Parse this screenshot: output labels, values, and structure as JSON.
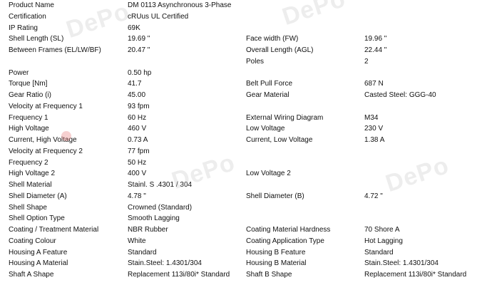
{
  "watermark": {
    "text": "DePo",
    "color": "#bebebe"
  },
  "rows": [
    {
      "c1": "Product Name",
      "c2": "DM 0113 Asynchronous 3-Phase",
      "c3": "",
      "c4": ""
    },
    {
      "c1": "Certification",
      "c2": "cRUus UL Certified",
      "c3": "",
      "c4": ""
    },
    {
      "c1": "IP Rating",
      "c2": "69K",
      "c3": "",
      "c4": ""
    },
    {
      "c1": "Shell Length (SL)",
      "c2": "19.69 \"",
      "c3": "Face width (FW)",
      "c4": "19.96 \""
    },
    {
      "c1": "Between Frames (EL/LW/BF)",
      "c2": "20.47 \"",
      "c3": "Overall Length (AGL)",
      "c4": "22.44 \""
    },
    {
      "c1": "",
      "c2": "",
      "c3": "Poles",
      "c4": "2"
    },
    {
      "c1": "Power",
      "c2": "0.50 hp",
      "c3": "",
      "c4": ""
    },
    {
      "c1": "Torque [Nm]",
      "c2": "41.7",
      "c3": "Belt Pull Force",
      "c4": "687 N"
    },
    {
      "c1": "Gear Ratio (i)",
      "c2": "45.00",
      "c3": "Gear Material",
      "c4": "Casted Steel: GGG-40"
    },
    {
      "c1": "Velocity at Frequency 1",
      "c2": "93 fpm",
      "c3": "",
      "c4": ""
    },
    {
      "c1": "Frequency 1",
      "c2": "60 Hz",
      "c3": "External Wiring Diagram",
      "c4": "M34"
    },
    {
      "c1": "High Voltage",
      "c2": "460 V",
      "c3": "Low Voltage",
      "c4": "230 V"
    },
    {
      "c1": "Current, High Voltage",
      "c2": "0.73 A",
      "c3": "Current, Low Voltage",
      "c4": "1.38 A"
    },
    {
      "c1": "Velocity at Frequency 2",
      "c2": "77 fpm",
      "c3": "",
      "c4": ""
    },
    {
      "c1": "Frequency 2",
      "c2": "50 Hz",
      "c3": "",
      "c4": ""
    },
    {
      "c1": "High Voltage 2",
      "c2": "400 V",
      "c3": "Low Voltage 2",
      "c4": ""
    },
    {
      "c1": "Shell Material",
      "c2": "Stainl. S      .4301 / 304",
      "c3": "",
      "c4": ""
    },
    {
      "c1": "Shell Diameter (A)",
      "c2": "4.78 \"",
      "c3": "Shell Diameter (B)",
      "c4": "4.72 \""
    },
    {
      "c1": "Shell Shape",
      "c2": "Crowned (Standard)",
      "c3": "",
      "c4": ""
    },
    {
      "c1": "Shell Option Type",
      "c2": "Smooth Lagging",
      "c3": "",
      "c4": ""
    },
    {
      "c1": "Coating / Treatment Material",
      "c2": "NBR Rubber",
      "c3": "Coating Material Hardness",
      "c4": "70 Shore A"
    },
    {
      "c1": "Coating Colour",
      "c2": "White",
      "c3": "Coating Application Type",
      "c4": "Hot Lagging"
    },
    {
      "c1": "Housing A Feature",
      "c2": "Standard",
      "c3": "Housing B Feature",
      "c4": "Standard"
    },
    {
      "c1": "Housing A Material",
      "c2": "Stain.Steel: 1.4301/304",
      "c3": "Housing B Material",
      "c4": "Stain.Steel: 1.4301/304"
    },
    {
      "c1": "Shaft A Shape",
      "c2": "Replacement 113i/80i* Standard",
      "c3": "Shaft B Shape",
      "c4": "Replacement 113i/80i* Standard"
    }
  ]
}
